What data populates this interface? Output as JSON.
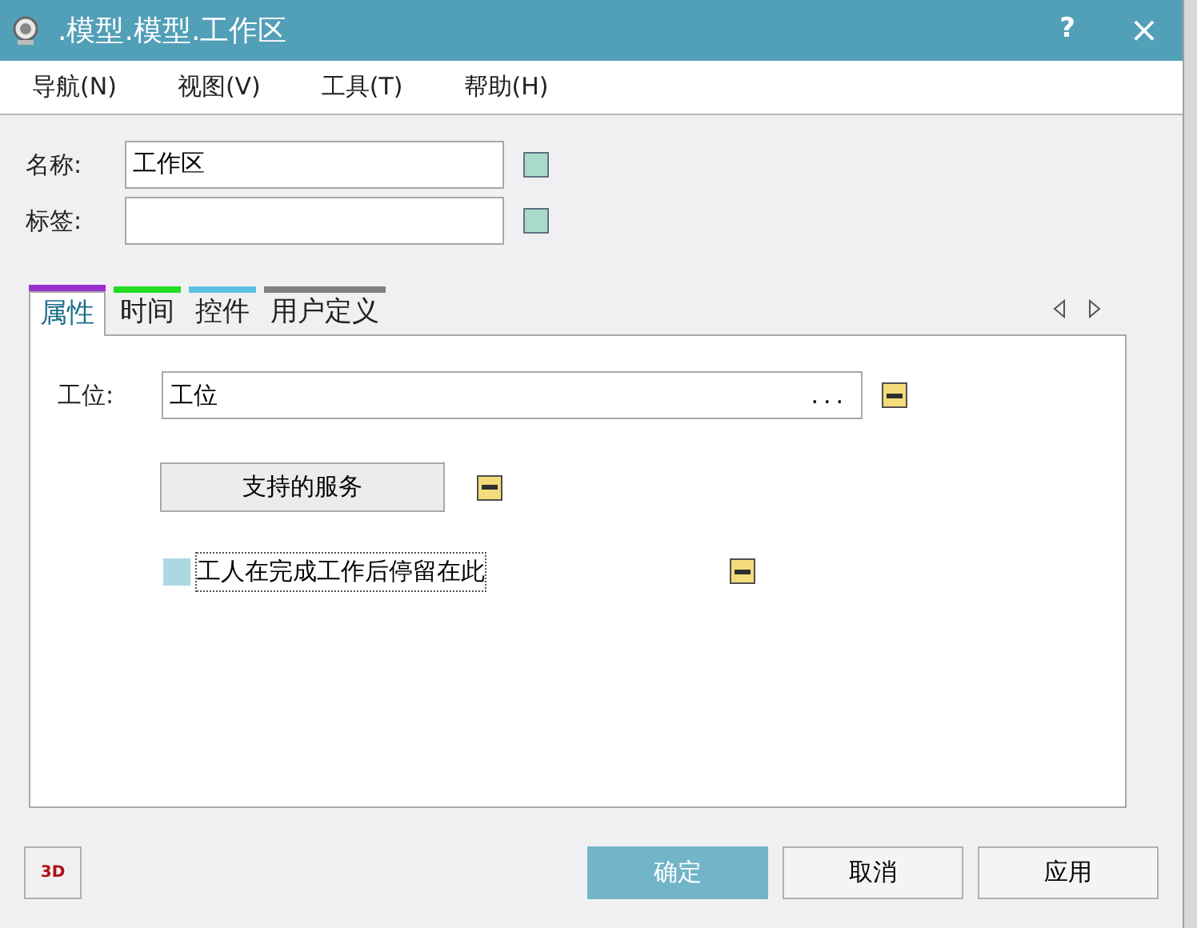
{
  "window": {
    "title": ".模型.模型.工作区",
    "help": "?",
    "close": "×"
  },
  "menu": [
    "导航(N)",
    "视图(V)",
    "工具(T)",
    "帮助(H)"
  ],
  "fields": [
    {
      "label": "名称:",
      "value": "工作区"
    },
    {
      "label": "标签:"
    }
  ],
  "tabs": [
    {
      "label": "属性",
      "selected": true,
      "color": "#9b30d0"
    },
    {
      "label": "时间",
      "selected": false,
      "color": "#22dd22"
    },
    {
      "label": "控件",
      "selected": false,
      "color": "#5bc0de"
    },
    {
      "label": "用户定义",
      "selected": false,
      "color": "#808080"
    }
  ],
  "panel": {
    "station_label": "工位:",
    "station_value": "工位",
    "browse": "...",
    "services_button": "支持的服务",
    "stay_checkbox": {
      "label": "工人在完成工作后停留在此",
      "checked": false
    }
  },
  "buttons": {
    "view3d": "3D",
    "ok": "确定",
    "cancel": "取消",
    "apply": "应用"
  }
}
